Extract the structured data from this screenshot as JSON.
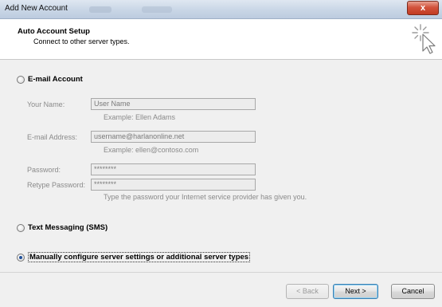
{
  "window": {
    "title": "Add New Account",
    "close_label": "x"
  },
  "header": {
    "title": "Auto Account Setup",
    "subtitle": "Connect to other server types."
  },
  "email_account": {
    "label": "E-mail Account",
    "selected": false,
    "fields": {
      "your_name": {
        "label": "Your Name:",
        "value": "User Name",
        "hint": "Example: Ellen Adams"
      },
      "email_address": {
        "label": "E-mail Address:",
        "value": "username@harlanonline.net",
        "hint": "Example: ellen@contoso.com"
      },
      "password": {
        "label": "Password:",
        "value": "********"
      },
      "retype_password": {
        "label": "Retype Password:",
        "value": "********",
        "hint": "Type the password your Internet service provider has given you."
      }
    }
  },
  "text_messaging": {
    "label": "Text Messaging (SMS)",
    "selected": false
  },
  "manual_config": {
    "label": "Manually configure server settings or additional server types",
    "selected": true
  },
  "buttons": {
    "back": "< Back",
    "next": "Next >",
    "cancel": "Cancel"
  }
}
